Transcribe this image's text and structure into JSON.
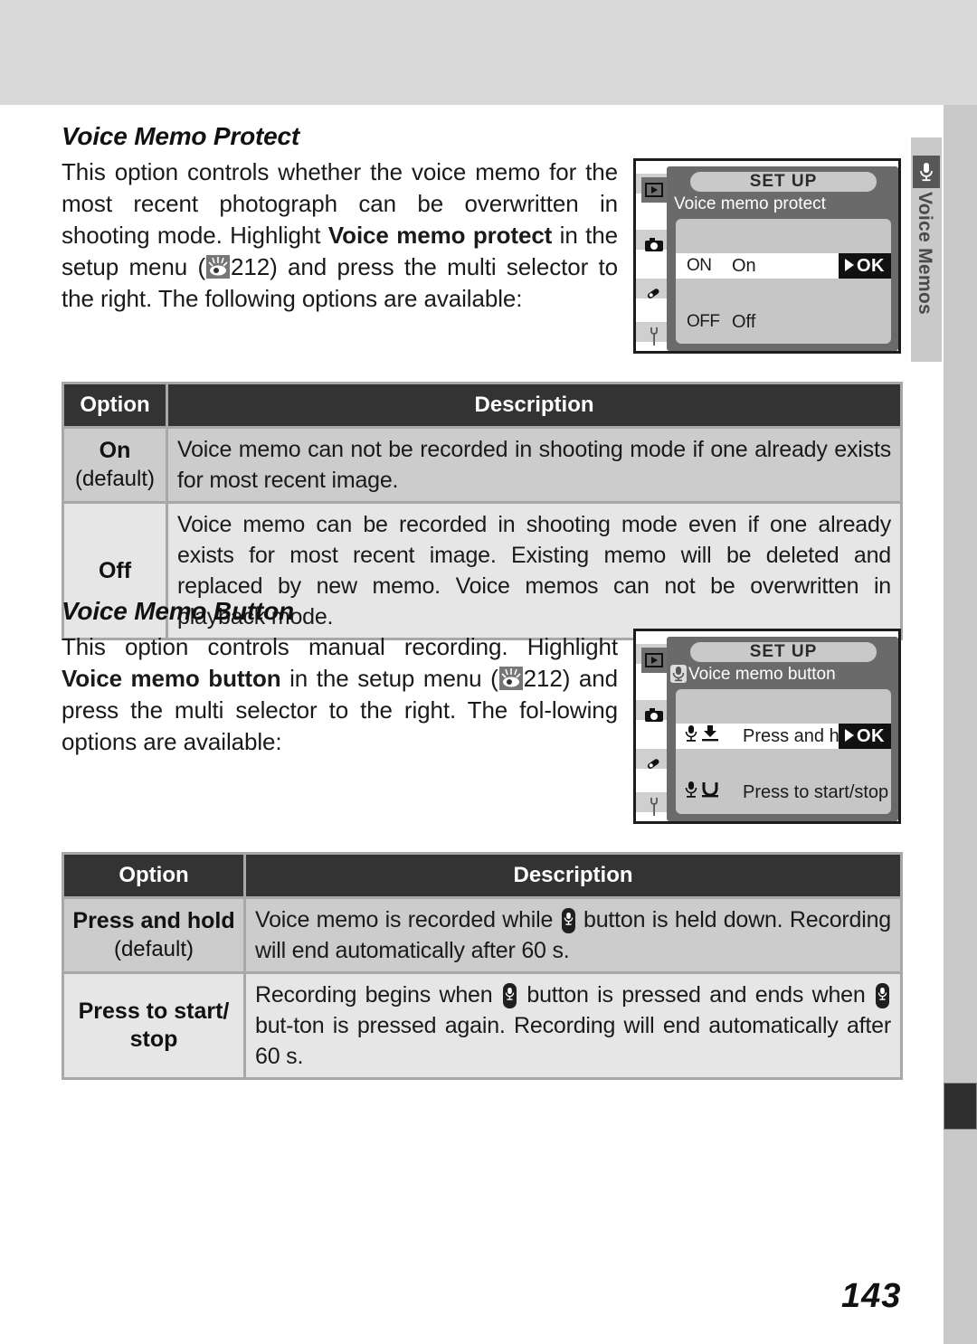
{
  "page": {
    "number": "143"
  },
  "side_tab": {
    "label": "Voice Memos",
    "icon": "microphone-icon"
  },
  "sections": [
    {
      "heading": "Voice Memo Protect",
      "paragraph_parts": {
        "a": "This option controls whether the voice memo for the most recent photograph can be overwritten in shooting mode.  Highlight ",
        "bold": "Voice memo protect",
        "b": " in the setup menu (",
        "ref": "212",
        "c": ") and press the multi selector to the right.  The following options are available:"
      }
    },
    {
      "heading": "Voice Memo Button",
      "paragraph_parts": {
        "a": "This option controls manual recording.  Highlight ",
        "bold": "Voice memo button",
        "b": " in the setup menu (",
        "ref": "212",
        "c": ") and press the multi selector to the right.  The fol-lowing options are available:"
      }
    }
  ],
  "lcd_protect": {
    "title": "SET  UP",
    "subtitle": "Voice memo protect",
    "rows": [
      {
        "code": "ON",
        "label": "On",
        "selected": true,
        "ok": "OK"
      },
      {
        "code": "OFF",
        "label": "Off",
        "selected": false
      }
    ],
    "side_icons": [
      "playback-icon",
      "camera-icon",
      "pencil-icon",
      "wrench-icon"
    ]
  },
  "lcd_button": {
    "title": "SET  UP",
    "subtitle": "Voice memo button",
    "rows": [
      {
        "icon": "mic-press-hold-icon",
        "label": "Press and hold",
        "selected": true,
        "ok": "OK"
      },
      {
        "icon": "mic-start-stop-icon",
        "label": "Press to start/stop",
        "selected": false
      }
    ],
    "side_icons": [
      "playback-icon",
      "camera-icon",
      "pencil-icon",
      "wrench-icon"
    ]
  },
  "table_protect": {
    "headers": {
      "option": "Option",
      "description": "Description"
    },
    "rows": [
      {
        "option": "On",
        "default_note": "(default)",
        "description": "Voice memo can not be recorded in shooting mode if one already exists for most recent image."
      },
      {
        "option": "Off",
        "default_note": "",
        "description": "Voice memo can be recorded in shooting mode even if one already exists for most recent image.  Existing memo will be deleted and replaced by new memo.  Voice memos can not be overwritten in playback mode."
      }
    ]
  },
  "table_button": {
    "headers": {
      "option": "Option",
      "description": "Description"
    },
    "rows": [
      {
        "option": "Press and hold",
        "default_note": "(default)",
        "desc_a": "Voice memo is recorded while ",
        "desc_b": " button is held down.  Recording will end automatically after 60 s.",
        "desc_c": "",
        "desc_d": ""
      },
      {
        "option": "Press to start/ stop",
        "default_note": "",
        "desc_a": "Recording begins when ",
        "desc_b": " button is pressed and ends when ",
        "desc_c": " but-ton is pressed again.  Recording will end automatically after 60 s.",
        "desc_d": ""
      }
    ]
  }
}
